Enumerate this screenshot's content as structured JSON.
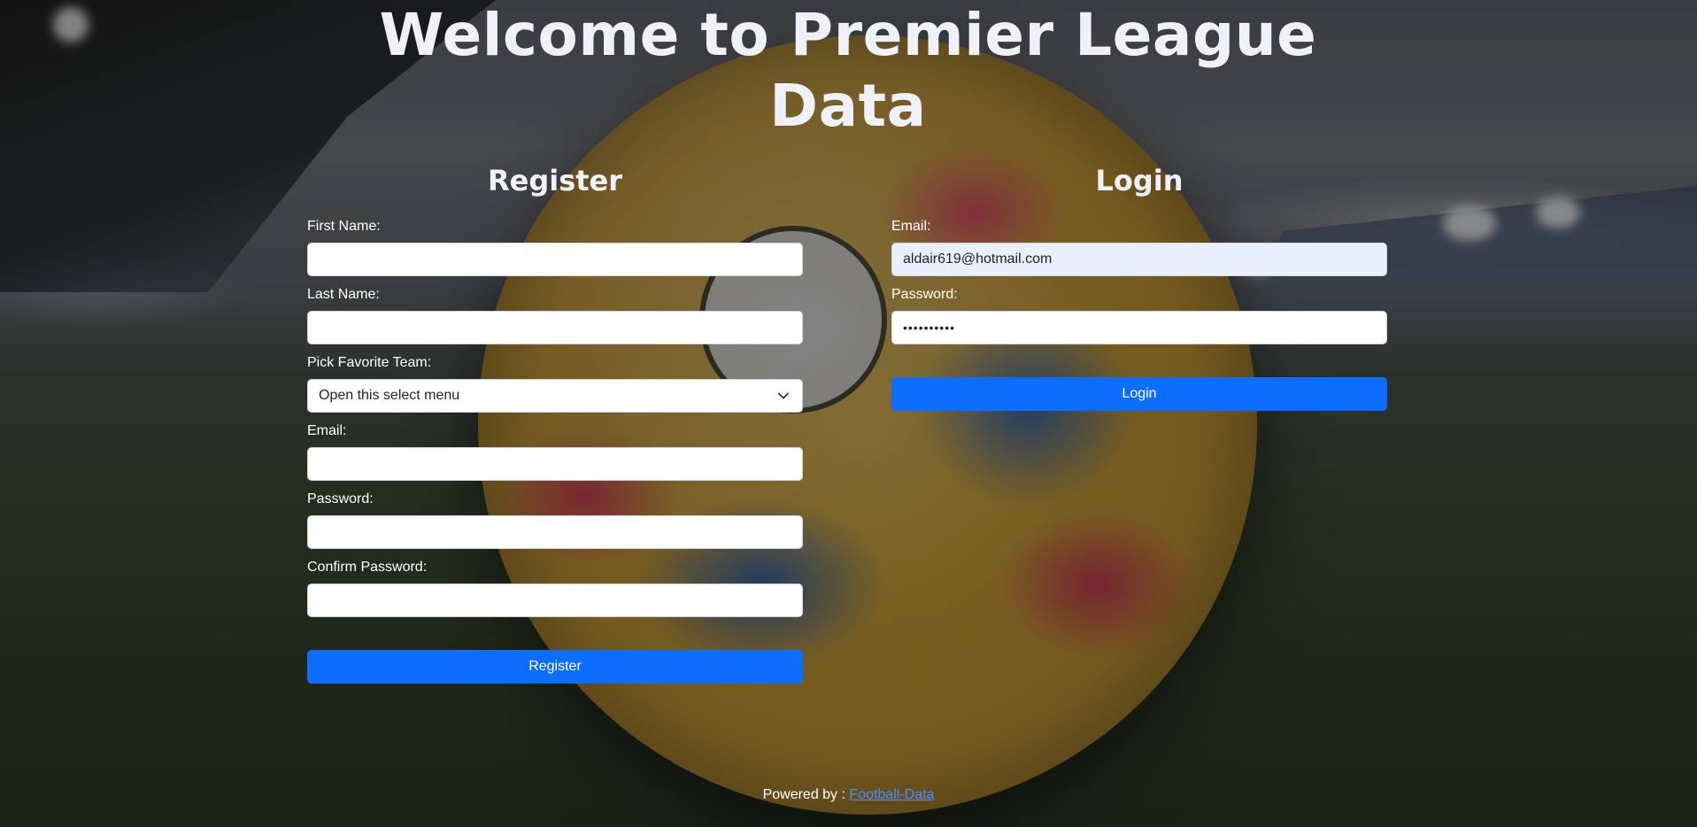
{
  "header": {
    "title": "Welcome to Premier League Data"
  },
  "register": {
    "title": "Register",
    "first_name_label": "First Name:",
    "first_name_value": "",
    "last_name_label": "Last Name:",
    "last_name_value": "",
    "team_label": "Pick Favorite Team:",
    "team_selected": "Open this select menu",
    "email_label": "Email:",
    "email_value": "",
    "password_label": "Password:",
    "password_value": "",
    "confirm_password_label": "Confirm Password:",
    "confirm_password_value": "",
    "submit_label": "Register"
  },
  "login": {
    "title": "Login",
    "email_label": "Email:",
    "email_value": "aldair619@hotmail.com",
    "password_label": "Password:",
    "password_value": "••••••••••",
    "submit_label": "Login"
  },
  "footer": {
    "powered_by_text": "Powered by : ",
    "link_text": "Football-Data"
  },
  "colors": {
    "primary_button": "#0d6efd",
    "autofill_background": "#e8f0fe",
    "link": "#4d8dff"
  }
}
